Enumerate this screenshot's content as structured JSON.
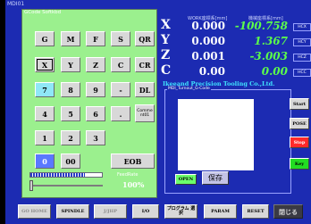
{
  "app": {
    "title": "MDI01"
  },
  "keypad": {
    "title": "GCode Softkbd",
    "keys": {
      "G": "G",
      "M": "M",
      "F": "F",
      "S": "S",
      "QR": "QR",
      "X": "X",
      "Y": "Y",
      "Z": "Z",
      "C": "C",
      "CR": "CR",
      "seven": "7",
      "eight": "8",
      "nine": "9",
      "minus": "-",
      "DL": "DL",
      "four": "4",
      "five": "5",
      "six": "6",
      "dot": ".",
      "comment": "Comme nt01",
      "one": "1",
      "two": "2",
      "three": "3",
      "zero": "0",
      "doublezero": "00",
      "EOB": "EOB"
    },
    "progress_fraction": 0.76,
    "slider_fraction": 0.0,
    "feedrate_label": "FeedRate",
    "feedrate_value": "100%"
  },
  "coords": {
    "work_header": "WORK座標系[mm]",
    "machine_header": "機械座標系[mm]",
    "rows": [
      {
        "axis": "X",
        "work": "0.000",
        "machine": "-100.758",
        "hc": "HCX"
      },
      {
        "axis": "Y",
        "work": "0.000",
        "machine": "1.367",
        "hc": "HCY"
      },
      {
        "axis": "Z",
        "work": "0.001",
        "machine": "-3.003",
        "hc": "HCZ"
      },
      {
        "axis": "C",
        "work": "0.00",
        "machine": "0.00",
        "hc": "HCC"
      }
    ]
  },
  "company": "Ikeeand Precision Tooling Co.,Ltd.",
  "mdi": {
    "group_label": "MDI_Turnout_G-Code",
    "start": "Start",
    "pose": "POSE",
    "stop": "Stop",
    "key": "Key",
    "open": "OPEN",
    "save": "保存"
  },
  "bottom": {
    "go_home": "GO HOME",
    "spindle": "SPINDLE",
    "jog": "J/JHP",
    "io": "I/O",
    "program_select": "プログラム 選択",
    "param": "PARAM",
    "reset": "RESET",
    "close": "閉じる"
  },
  "colors": {
    "background": "#1c2bb2",
    "keypad_bg": "#9bf08e",
    "machine_value": "#5cff4a",
    "company": "#3fe3ff",
    "stop_button": "#ff2a2a",
    "key_button": "#22dd22"
  }
}
